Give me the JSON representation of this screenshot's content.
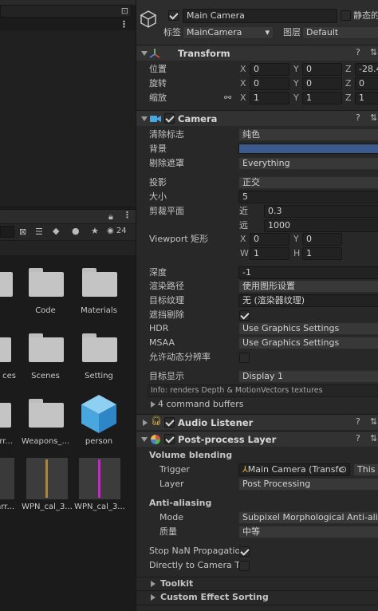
{
  "project_panel": {
    "lock_icon": "lock-icon",
    "count": "24",
    "assets": [
      {
        "label": "",
        "kind": "folder"
      },
      {
        "label": "Code",
        "kind": "folder"
      },
      {
        "label": "Materials",
        "kind": "folder"
      },
      {
        "label": "ces",
        "kind": "folder"
      },
      {
        "label": "Scenes",
        "kind": "folder"
      },
      {
        "label": "Setting",
        "kind": "folder"
      },
      {
        "label": "arr...",
        "kind": "folder"
      },
      {
        "label": "Weapons_...",
        "kind": "folder"
      },
      {
        "label": "person",
        "kind": "prefab"
      },
      {
        "label": "earr...",
        "kind": "texture"
      },
      {
        "label": "WPN_cal_3...",
        "kind": "texture"
      },
      {
        "label": "WPN_cal_3...",
        "kind": "texture"
      }
    ]
  },
  "inspector": {
    "object_name": "Main Camera",
    "static_label": "静态的",
    "tag_label": "标签",
    "tag_value": "MainCamera",
    "layer_label": "图层",
    "layer_value": "Default",
    "transform": {
      "title": "Transform",
      "position_label": "位置",
      "rotation_label": "旋转",
      "scale_label": "缩放",
      "position": {
        "x": "0",
        "y": "0",
        "z": "-28.4"
      },
      "rotation": {
        "x": "0",
        "y": "0",
        "z": "0"
      },
      "scale": {
        "x": "1",
        "y": "1",
        "z": "1"
      }
    },
    "camera": {
      "title": "Camera",
      "clear_flags_label": "清除标志",
      "clear_flags_value": "纯色",
      "background_label": "背景",
      "background_color": "#3d5a8c",
      "culling_mask_label": "剔除遮罩",
      "culling_mask_value": "Everything",
      "projection_label": "投影",
      "projection_value": "正交",
      "size_label": "大小",
      "size_value": "5",
      "clipping_label": "剪裁平面",
      "near_label": "近",
      "near_value": "0.3",
      "far_label": "远",
      "far_value": "1000",
      "viewport_label": "Viewport 矩形",
      "vp_x": "0",
      "vp_y": "0",
      "vp_w": "1",
      "vp_h": "1",
      "depth_label": "深度",
      "depth_value": "-1",
      "render_path_label": "渲染路径",
      "render_path_value": "使用图形设置",
      "target_texture_label": "目标纹理",
      "target_texture_value": "无 (渲染器纹理)",
      "occlusion_label": "遮挡剔除",
      "hdr_label": "HDR",
      "hdr_value": "Use Graphics Settings",
      "msaa_label": "MSAA",
      "msaa_value": "Use Graphics Settings",
      "dynamic_res_label": "允许动态分辨率",
      "target_display_label": "目标显示",
      "target_display_value": "Display 1",
      "info": "Info: renders Depth & MotionVectors textures",
      "command_buffers": "4 command buffers"
    },
    "audio_listener": {
      "title": "Audio Listener"
    },
    "post_process": {
      "title": "Post-process Layer",
      "volume_blending": "Volume blending",
      "trigger_label": "Trigger",
      "trigger_value": "Main Camera (Transfc",
      "this_label": "This",
      "layer_label": "Layer",
      "layer_value": "Post Processing",
      "anti_aliasing": "Anti-aliasing",
      "mode_label": "Mode",
      "mode_value": "Subpixel Morphological Anti-alias",
      "quality_label": "质量",
      "quality_value": "中等",
      "stop_nan_label": "Stop NaN Propagatio",
      "direct_label": "Directly to Camera Ta",
      "toolkit": "Toolkit",
      "custom_sorting": "Custom Effect Sorting"
    }
  }
}
